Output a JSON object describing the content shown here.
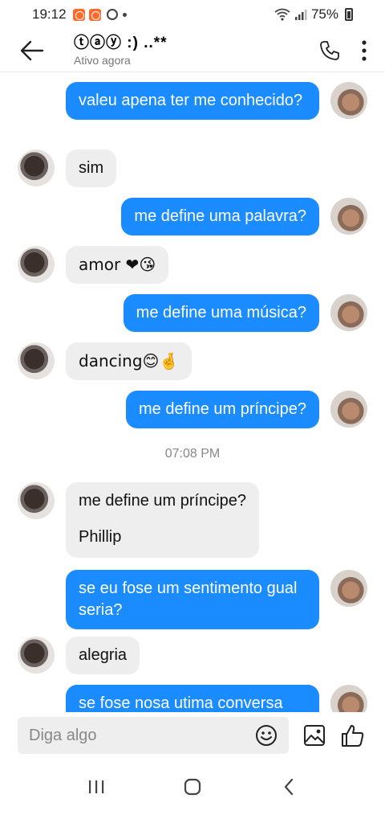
{
  "status_bar": {
    "time": "19:12",
    "battery": "75%"
  },
  "header": {
    "title": "ⓣⓐⓨ :)  ..**",
    "subtitle": "Ativo agora"
  },
  "messages": [
    {
      "from": "me",
      "text": "valeu apena ter me conhecido?"
    },
    {
      "from": "them",
      "text": "sim"
    },
    {
      "from": "me",
      "text": "me define uma palavra?"
    },
    {
      "from": "them",
      "text": "amor ❤😘"
    },
    {
      "from": "me",
      "text": "me define uma música?"
    },
    {
      "from": "them",
      "text": "dancing😊🤞"
    },
    {
      "from": "me",
      "text": "me define um príncipe?"
    },
    {
      "from": "them",
      "text": "me define um príncipe?"
    },
    {
      "from": "them",
      "text": "Phillip"
    },
    {
      "from": "me",
      "text": "se eu fose um sentimento gual seria?"
    },
    {
      "from": "them",
      "text": "alegria"
    },
    {
      "from": "me",
      "text": "se fose nosa utima conversa"
    }
  ],
  "timestamp": "07:08 PM",
  "composer": {
    "placeholder": "Diga algo"
  },
  "icons": [
    "back-arrow-icon",
    "phone-icon",
    "more-vertical-icon",
    "emoji-icon",
    "image-icon",
    "thumbs-up-icon",
    "recent-apps-icon",
    "home-icon",
    "back-nav-icon"
  ],
  "colors": {
    "outgoing_bubble": "#1a8cff",
    "incoming_bubble": "#eeeeee"
  }
}
